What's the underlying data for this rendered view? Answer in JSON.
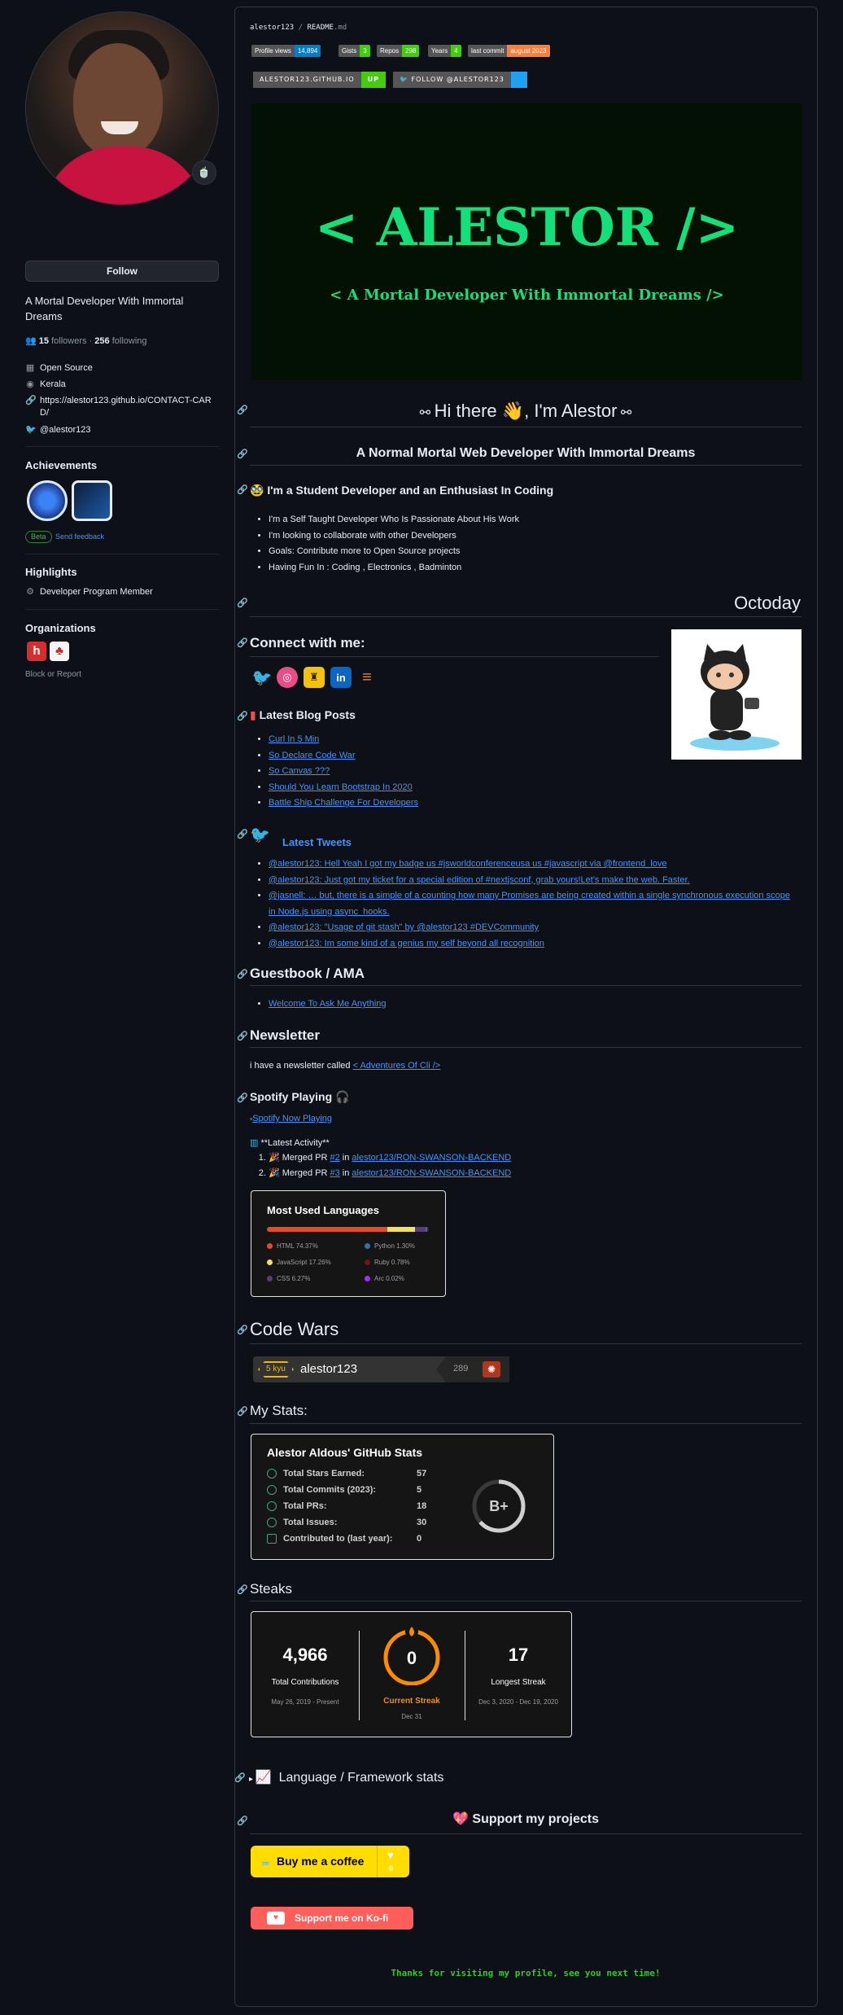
{
  "profile": {
    "follow_label": "Follow",
    "bio": "A Mortal Developer With Immortal Dreams",
    "followers_count": "15",
    "followers_label": "followers",
    "following_count": "256",
    "following_label": "following",
    "separator": "·",
    "vcard": {
      "company": "Open Source",
      "location": "Kerala",
      "website": "https://alestor123.github.io/CONTACT-CARD/",
      "twitter": "@alestor123"
    },
    "status_emoji": "🍵"
  },
  "achievements": {
    "heading": "Achievements",
    "beta_label": "Beta",
    "feedback_label": "Send feedback"
  },
  "highlights": {
    "heading": "Highlights",
    "item": "Developer Program Member"
  },
  "organizations": {
    "heading": "Organizations",
    "block_label": "Block or Report"
  },
  "readme": {
    "crumb_user": "alestor123",
    "crumb_sep": " / ",
    "crumb_file": "README",
    "crumb_ext": ".md",
    "badges": [
      {
        "label": "Profile views",
        "value": "14,894",
        "color": "#007ec6"
      },
      {
        "label": "Gists",
        "value": "3",
        "color": "#4c1"
      },
      {
        "label": "Repos",
        "value": "298",
        "color": "#4c1"
      },
      {
        "label": "Years",
        "value": "4",
        "color": "#4c1"
      },
      {
        "label": "last commit",
        "value": "august 2023",
        "color": "#fe7d37"
      }
    ],
    "badges2": [
      {
        "label": "ALESTOR123.GITHUB.IO",
        "value": "UP",
        "color": "#4c1"
      },
      {
        "label": "FOLLOW @ALESTOR123",
        "value": "",
        "color": "#1da1f2"
      }
    ],
    "banner_title": "< ALESTOR />",
    "banner_subtitle": "< A Mortal Developer With Immortal Dreams />",
    "greeting": "Hi there",
    "greeting_name": ", I'm Alestor",
    "tagline": "A Normal Mortal Web Developer With Immortal Dreams",
    "student_heading": "I'm a Student Developer and an Enthusiast In Coding",
    "about_list": [
      "I'm a Self Taught Developer Who Is Passionate About His Work",
      "I'm looking to collaborate with other Developers",
      "Goals: Contribute more to Open Source projects",
      "Having Fun In : Coding , Electronics , Badminton"
    ],
    "octoday": "Octoday",
    "connect_heading": "Connect with me:",
    "blog_heading": "Latest Blog Posts",
    "blog_posts": [
      "Curl In 5 Min",
      "So Declare Code War",
      "So Canvas ???",
      "Should You Learn Bootstrap In 2020",
      "Battle Ship Challenge For Developers"
    ],
    "tweets_heading": "Latest Tweets",
    "tweets": [
      "@alestor123: Hell Yeah I got my badge us #jsworldconferenceusa us #javascript via @frontend_love",
      "@alestor123: Just got my ticket for a special edition of #nextjsconf, grab yours!Let's make the web. Faster.",
      "@jasnell: … but, there is a simple of a counting how many Promises are being created within a single synchronous execution scope in Node.js using async_hooks.",
      "@alestor123: \"Usage of git stash\" by @alestor123 #DEVCommunity",
      "@alestor123: Im some kind of a genius my self beyond all recognition"
    ],
    "guestbook_heading": "Guestbook / AMA",
    "guestbook_link": "Welcome To Ask Me Anything",
    "newsletter_heading": "Newsletter",
    "newsletter_text": "i have a newsletter called ",
    "newsletter_link": "< Adventures Of Cli />",
    "spotify_heading": "Spotify Playing",
    "spotify_img_alt": "Spotify Now Playing",
    "activity_heading": "**Latest Activity**",
    "activity": [
      {
        "pre": "Merged PR ",
        "num": "#2",
        "mid": " in ",
        "repo": "alestor123/RON-SWANSON-BACKEND"
      },
      {
        "pre": "Merged PR ",
        "num": "#3",
        "mid": " in ",
        "repo": "alestor123/RON-SWANSON-BACKEND"
      }
    ],
    "langs_card": {
      "title": "Most Used Languages",
      "items": [
        {
          "name": "HTML 74.37%",
          "color": "#e34c26",
          "pct": 74.37
        },
        {
          "name": "Python 1.30%",
          "color": "#3572A5",
          "pct": 1.3
        },
        {
          "name": "JavaScript 17.26%",
          "color": "#f1e05a",
          "pct": 17.26
        },
        {
          "name": "Ruby 0.78%",
          "color": "#701516",
          "pct": 0.78
        },
        {
          "name": "CSS 6.27%",
          "color": "#563d7c",
          "pct": 6.27
        },
        {
          "name": "Arc 0.02%",
          "color": "#aa2afe",
          "pct": 0.02
        }
      ]
    },
    "codewars_heading": "Code Wars",
    "codewars": {
      "rank": "5 kyu",
      "user": "alestor123",
      "honor": "289"
    },
    "stats_heading": "My Stats:",
    "stats_card": {
      "title": "Alestor Aldous' GitHub Stats",
      "rows": [
        {
          "label": "Total Stars Earned:",
          "value": "57"
        },
        {
          "label": "Total Commits (2023):",
          "value": "5"
        },
        {
          "label": "Total PRs:",
          "value": "18"
        },
        {
          "label": "Total Issues:",
          "value": "30"
        },
        {
          "label": "Contributed to (last year):",
          "value": "0"
        }
      ],
      "grade": "B+"
    },
    "streaks_heading": "Steaks",
    "streaks_card": {
      "total": "4,966",
      "total_label": "Total Contributions",
      "total_range": "May 26, 2019 - Present",
      "current": "0",
      "current_label": "Current Streak",
      "current_range": "Dec 31",
      "longest": "17",
      "longest_label": "Longest Streak",
      "longest_range": "Dec 3, 2020 - Dec 19, 2020"
    },
    "lang_stats_heading": "Language / Framework stats",
    "support_heading": "Support my projects",
    "coffee_label": "Buy me a coffee",
    "coffee_count": "0",
    "kofi_label": "Support me on Ko-fi",
    "thanks": "Thanks for visiting my profile, see you next time!"
  },
  "colors": {
    "background": "#0d1117",
    "link": "#4493f8",
    "banner_green": "#14e07a",
    "streak_orange": "#fb8c00"
  }
}
